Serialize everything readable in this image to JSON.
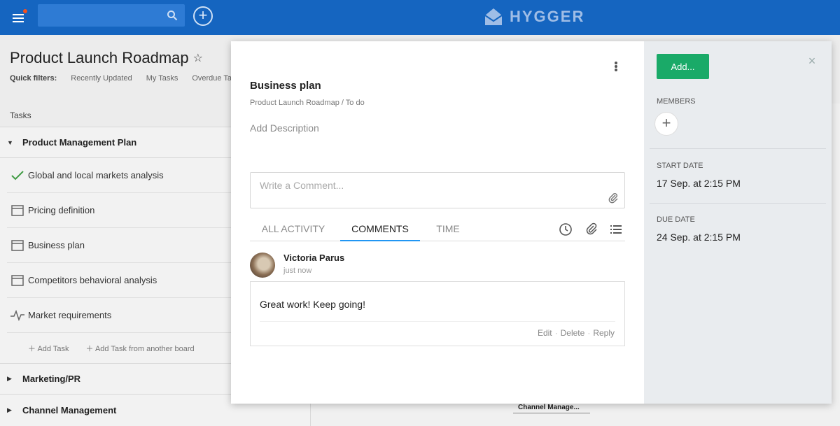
{
  "header": {
    "logo_text": "HYGGER",
    "search_placeholder": ""
  },
  "board": {
    "title": "Product Launch Roadmap",
    "quick_filters_label": "Quick filters:",
    "quick_filters": [
      "Recently Updated",
      "My Tasks",
      "Overdue Tasks"
    ],
    "tasks_header": "Tasks",
    "groups": [
      {
        "name": "Product Management Plan",
        "expanded": true
      },
      {
        "name": "Marketing/PR",
        "expanded": false
      },
      {
        "name": "Channel Management",
        "expanded": false
      }
    ],
    "tasks": [
      {
        "label": "Global and local markets analysis",
        "icon": "check-icon"
      },
      {
        "label": "Pricing definition",
        "icon": "card-icon"
      },
      {
        "label": "Business plan",
        "icon": "card-icon"
      },
      {
        "label": "Competitors behavioral analysis",
        "icon": "card-icon"
      },
      {
        "label": "Market requirements",
        "icon": "pulse-icon"
      }
    ],
    "add_task": "Add Task",
    "add_task_from_board": "Add Task from another board",
    "gantt_bar_label": "Channel Manage..."
  },
  "modal": {
    "title": "Business plan",
    "breadcrumb": "Product Launch Roadmap / To do",
    "description_placeholder": "Add Description",
    "comment_placeholder": "Write a Comment...",
    "tabs": [
      {
        "label": "ALL ACTIVITY",
        "active": false
      },
      {
        "label": "COMMENTS",
        "active": true
      },
      {
        "label": "TIME",
        "active": false
      }
    ],
    "comment": {
      "author": "Victoria Parus",
      "time": "just now",
      "text": "Great work! Keep going!",
      "actions": [
        "Edit",
        "Delete",
        "Reply"
      ]
    }
  },
  "side": {
    "add_button": "Add...",
    "members_label": "MEMBERS",
    "start_date_label": "START DATE",
    "start_date": "17 Sep. at 2:15 PM",
    "due_date_label": "DUE DATE",
    "due_date": "24 Sep. at 2:15 PM"
  },
  "colors": {
    "header": "#1565c0",
    "accent_green": "#1aaa68",
    "tab_underline": "#2196f3",
    "side_panel": "#e9ecef"
  }
}
